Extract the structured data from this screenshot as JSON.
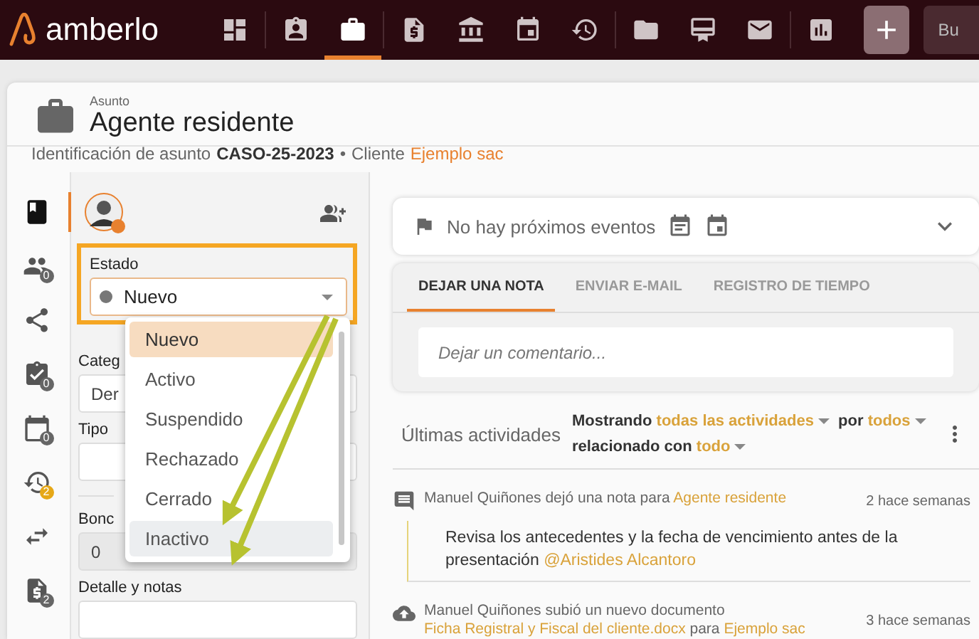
{
  "topbar": {
    "logo": "amberlo",
    "nav": [
      {
        "kind": "dashboard",
        "selected": false
      },
      {
        "kind": "contacts",
        "selected": false
      },
      {
        "kind": "matters",
        "selected": true
      },
      {
        "kind": "invoices",
        "selected": false
      },
      {
        "kind": "bank",
        "selected": false
      },
      {
        "kind": "calendar",
        "selected": false
      },
      {
        "kind": "time",
        "selected": false
      },
      {
        "kind": "folder",
        "selected": false
      },
      {
        "kind": "certificate",
        "selected": false
      },
      {
        "kind": "mail",
        "selected": false
      },
      {
        "kind": "reports",
        "selected": false
      }
    ],
    "search_button": "Bu"
  },
  "header": {
    "label": "Asunto",
    "title": "Agente residente",
    "id_label": "Identificación de asunto",
    "id_value": "CASO-25-2023",
    "separator": "•",
    "client_label": "Cliente",
    "client": "Ejemplo sac"
  },
  "rail": [
    {
      "kind": "notes",
      "selected": true
    },
    {
      "kind": "people",
      "selected": false,
      "badge": "0"
    },
    {
      "kind": "share",
      "selected": false
    },
    {
      "kind": "tasks",
      "selected": false,
      "badge": "0"
    },
    {
      "kind": "events",
      "selected": false,
      "badge": "0"
    },
    {
      "kind": "time",
      "selected": false,
      "badge": "2",
      "alert": true
    },
    {
      "kind": "transfers",
      "selected": false
    },
    {
      "kind": "invoices",
      "selected": false,
      "badge": "2"
    }
  ],
  "form": {
    "status_label": "Estado",
    "status_value": "Nuevo",
    "fields": [
      {
        "label": "Categ",
        "value": "Der"
      },
      {
        "label": "Tipo"
      },
      {
        "label": "Bonc",
        "value": "0",
        "disabled": true
      },
      {
        "label": "Detalle y notas"
      }
    ],
    "status_options": [
      {
        "label": "Nuevo",
        "selected": true,
        "hovered": false
      },
      {
        "label": "Activo",
        "selected": false,
        "hovered": false
      },
      {
        "label": "Suspendido",
        "selected": false,
        "hovered": false
      },
      {
        "label": "Rechazado",
        "selected": false,
        "hovered": false
      },
      {
        "label": "Cerrado",
        "selected": false,
        "hovered": false
      },
      {
        "label": "Inactivo",
        "selected": false,
        "hovered": true
      }
    ]
  },
  "events": {
    "text": "No hay próximos eventos"
  },
  "tabs": [
    {
      "label": "DEJAR UNA NOTA",
      "selected": true
    },
    {
      "label": "ENVIAR E-MAIL",
      "selected": false
    },
    {
      "label": "REGISTRO DE TIEMPO",
      "selected": false
    }
  ],
  "comment": {
    "placeholder": "Dejar un comentario..."
  },
  "activity": {
    "title": "Últimas actividades",
    "filter_1": "Mostrando",
    "filter_1_link": "todas las actividades",
    "filter_2": "por",
    "filter_2_link": "todos",
    "filter_3": "relacionado con",
    "filter_3_link": "todo",
    "entries": [
      {
        "kind": "note",
        "text": "Manuel Quiñones dejó una nota para",
        "target": "Agente residente",
        "time": "2 hace semanas",
        "body": "Revisa los antecedentes y la fecha de vencimiento antes de la presentación",
        "mention": "@Aristides Alcantoro"
      },
      {
        "kind": "upload",
        "text": "Manuel Quiñones subió un nuevo documento",
        "target": "Ficha Registral y Fiscal del cliente.docx",
        "text_2": "para",
        "target_2": "Ejemplo sac",
        "time": "3 hace semanas"
      }
    ]
  }
}
